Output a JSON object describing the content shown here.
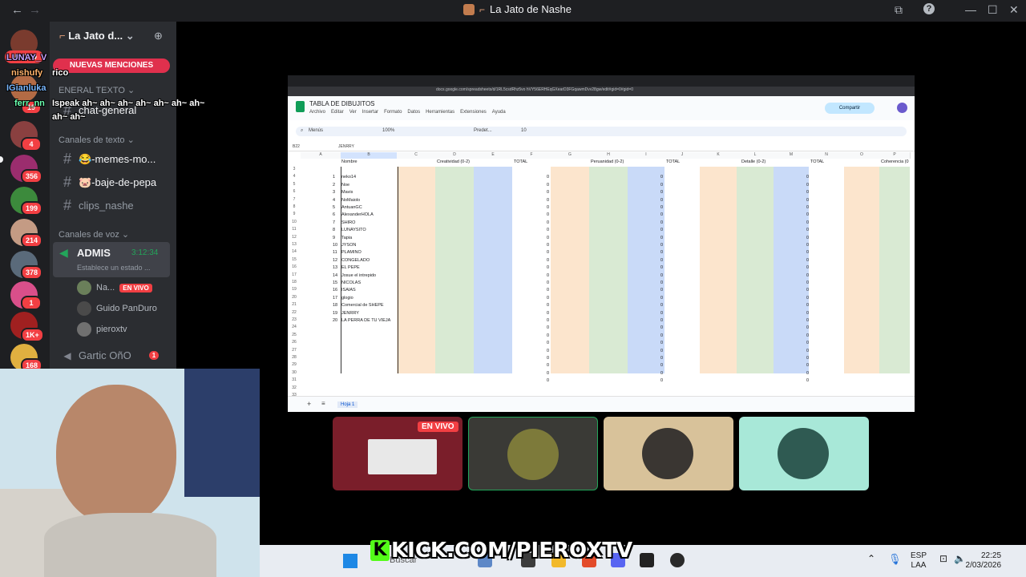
{
  "window": {
    "title": "La Jato de Nashe"
  },
  "rail": {
    "nuevo_label": "NUEVO",
    "badges": [
      "19",
      "4",
      "356",
      "199",
      "214",
      "378",
      "1",
      "1K+",
      "168"
    ]
  },
  "server": {
    "name": "La Jato d...",
    "mentions_label": "NUEVAS MENCIONES",
    "partial_category": "ENERAL TEXTO",
    "partial_channel": "chat-general",
    "text_category": "Canales de texto",
    "channels": [
      "😂-memes-mo...",
      "🐷-baje-de-pepa",
      "clips_nashe"
    ],
    "voice_category": "Canales de voz",
    "voice_channel": {
      "name": "ADMIS",
      "timer": "3:12:34",
      "status": "Establece un estado ..."
    },
    "members": [
      {
        "name": "Na...",
        "badge": "EN VIVO"
      },
      {
        "name": "Guido PanDuro"
      },
      {
        "name": "pieroxtv"
      }
    ],
    "gartic": {
      "name": "Gartic OñO",
      "badge": "1"
    }
  },
  "chat_overlay": {
    "lines": [
      "LUNAY_V",
      "nishufy",
      "rico",
      "IGianluka",
      "ferr_nn",
      "Ispeak ah~ ah~ ah~ ah~ ah~ ah~ ah~",
      "ah~ ah~"
    ]
  },
  "sheet": {
    "url": "docs.google.com/spreadsheets/d/1RL5csdRhz5vo hVY56ERHEqGXearD3FGqawmDvv28gw/edit#gid=0#gid=0",
    "title": "TABLA DE DIBUJITOS",
    "menus": [
      "Archivo",
      "Editar",
      "Ver",
      "Insertar",
      "Formato",
      "Datos",
      "Herramientas",
      "Extensiones",
      "Ayuda"
    ],
    "share_label": "Compartir",
    "toolbar": {
      "menus": "Menús",
      "zoom": "100%",
      "font": "Predet...",
      "size": "10"
    },
    "cell_ref": "B22",
    "formula": "JENRRY",
    "columns": [
      "A",
      "B",
      "C",
      "D",
      "E",
      "F",
      "G",
      "H",
      "I",
      "J",
      "K",
      "L",
      "M",
      "N",
      "O",
      "P"
    ],
    "headers": {
      "nombre": "Nombre",
      "creatividad": "Creatividad (0-2)",
      "total": "TOTAL",
      "persuasion": "Peruanidad (0-2)",
      "detalle": "Detalle (0-2)",
      "coherencia": "Coherencia (0"
    },
    "participants": [
      "neko14",
      "Noe",
      "Mavis",
      "NoMaiolo",
      "AntuanGC",
      "AlexanderHOLA",
      "SHIRO",
      "LUNAYSITO",
      "Tapia",
      "JYSON",
      "PLAMINO",
      "CONGELADO",
      "EL PEPE",
      "Josue el intrepido",
      "NICOLAS",
      "ISAIAS",
      "glogio",
      "Comercial de SHEPE",
      "JENRRY",
      "LA PERRA DE TU VIEJA"
    ],
    "total_value": "0",
    "tab": "Hoja 1"
  },
  "tiles": {
    "live_label": "EN VIVO"
  },
  "taskbar": {
    "search_placeholder": "Buscar",
    "watermark": "KICK.COM/PIEROXTV",
    "watermark_k": "K",
    "lang_1": "ESP",
    "lang_2": "LAA",
    "time": "22:25",
    "date": "2/03/2026"
  },
  "colors": {
    "accent_red": "#f23f43",
    "kick_green": "#53fc18",
    "peach": "#fce5cd",
    "green": "#d9ead3",
    "blue": "#c9daf8"
  }
}
